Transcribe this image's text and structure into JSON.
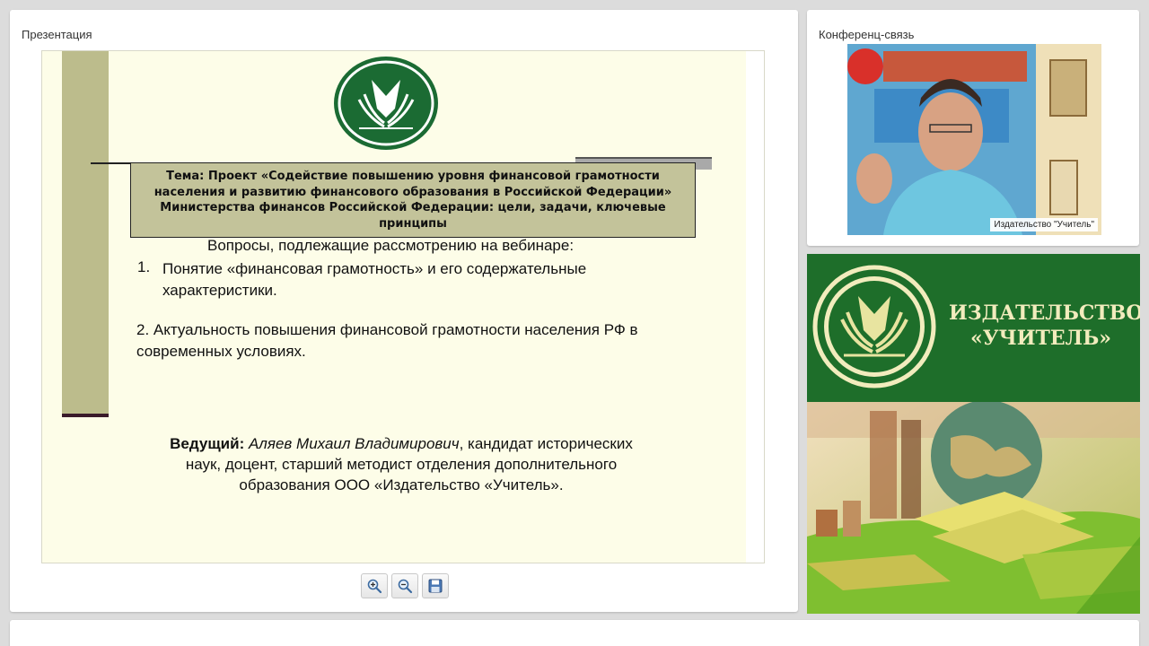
{
  "presentation": {
    "title": "Презентация",
    "slide": {
      "topic": "Тема: Проект «Содействие повышению уровня финансовой грамотности населения и развитию финансового образования в Российской Федерации» Министерства финансов Российской Федерации: цели, задачи, ключевые принципы",
      "questions_heading": "Вопросы, подлежащие рассмотрению на вебинаре:",
      "question1_number": "1.",
      "question1_text": "Понятие «финансовая грамотность» и его содержательные характеристики.",
      "question2_text": "2. Актуальность повышения финансовой грамотности населения РФ в современных условиях.",
      "presenter_label": "Ведущий:",
      "presenter_name": "Аляев Михаил Владимирович",
      "presenter_details": ", кандидат исторических наук, доцент, старший методист отделения дополнительного образования ООО «Издательство «Учитель»."
    },
    "toolbar": {
      "zoom_in_icon": "zoom-in-icon",
      "zoom_out_icon": "zoom-out-icon",
      "save_icon": "floppy-disk-icon"
    }
  },
  "conference": {
    "title": "Конференц-связь",
    "camera_caption": "Издательство \"Учитель\""
  },
  "publisher": {
    "name_line1": "ИЗДАТЕЛЬСТВО",
    "name_line2": "«УЧИТЕЛЬ»"
  },
  "colors": {
    "slide_bg": "#fdfde8",
    "topic_box": "#c3c39a",
    "stripe": "#bcbc8c",
    "brand_green": "#1e6e2a",
    "brand_cream": "#f2ecbd"
  }
}
